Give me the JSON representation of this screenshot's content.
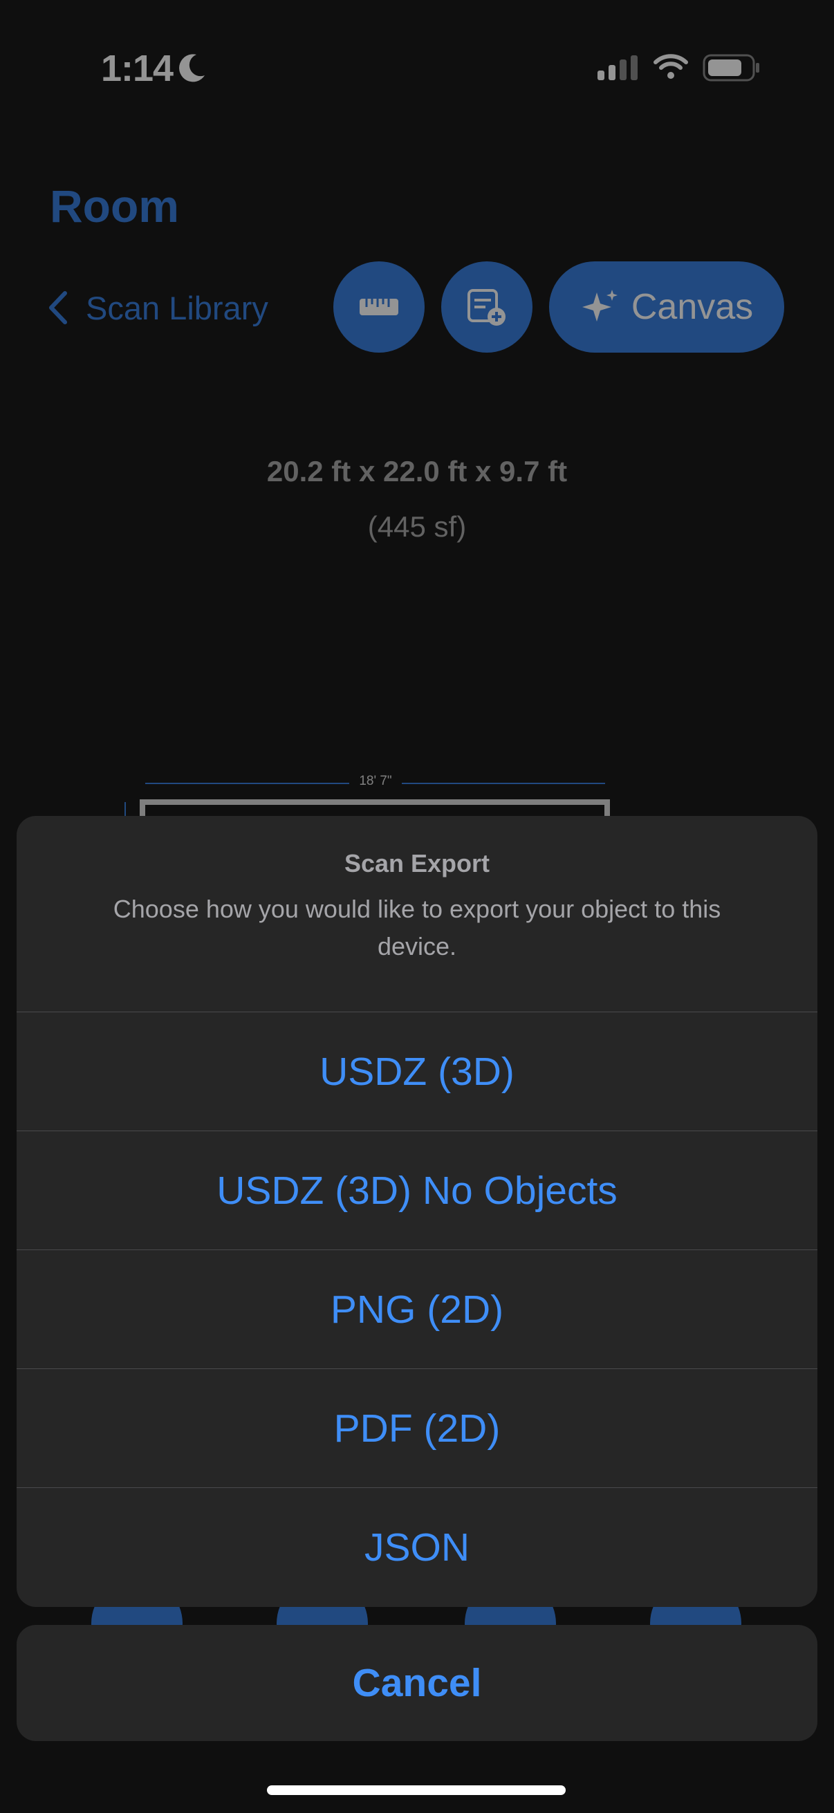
{
  "status_bar": {
    "time": "1:14",
    "icons": [
      "moon-icon",
      "cellular-signal-icon",
      "wifi-icon",
      "battery-icon"
    ]
  },
  "header": {
    "title": "Room",
    "back_label": "Scan Library",
    "canvas_label": "Canvas",
    "icons": [
      "chevron-left-icon",
      "ruler-icon",
      "document-add-icon",
      "sparkles-icon"
    ]
  },
  "room": {
    "dimensions": "20.2 ft x 22.0 ft x 9.7 ft",
    "area": "(445 sf)",
    "wall_measure": "18' 7\""
  },
  "action_sheet": {
    "title": "Scan Export",
    "message": "Choose how you would like to export your object to this device.",
    "options": [
      {
        "label": "USDZ (3D)"
      },
      {
        "label": "USDZ (3D) No Objects"
      },
      {
        "label": "PNG (2D)"
      },
      {
        "label": "PDF (2D)"
      },
      {
        "label": "JSON"
      }
    ],
    "cancel_label": "Cancel"
  },
  "colors": {
    "accent": "#3a7fdc",
    "sheet_link": "#3f8ef7",
    "sheet_background": "#262626",
    "screen_background": "#000000"
  }
}
